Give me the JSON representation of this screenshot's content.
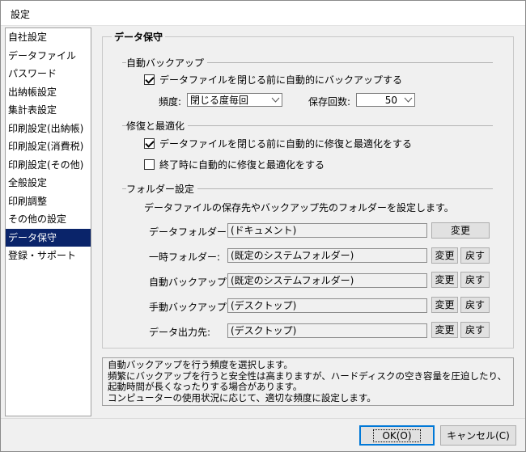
{
  "window": {
    "title": "設定"
  },
  "sidebar": {
    "items": [
      {
        "label": "自社設定"
      },
      {
        "label": "データファイル"
      },
      {
        "label": "パスワード"
      },
      {
        "label": "出納帳設定"
      },
      {
        "label": "集計表設定"
      },
      {
        "label": "印刷設定(出納帳)"
      },
      {
        "label": "印刷設定(消費税)"
      },
      {
        "label": "印刷設定(その他)"
      },
      {
        "label": "全般設定"
      },
      {
        "label": "印刷調整"
      },
      {
        "label": "その他の設定"
      },
      {
        "label": "データ保守",
        "selected": true
      },
      {
        "label": "登録・サポート"
      }
    ]
  },
  "panel": {
    "title": "データ保守"
  },
  "auto_backup": {
    "title": "自動バックアップ",
    "checkbox_label": "データファイルを閉じる前に自動的にバックアップする",
    "checked": true,
    "frequency_label": "頻度:",
    "frequency_value": "閉じる度毎回",
    "count_label": "保存回数:",
    "count_value": "50"
  },
  "repair": {
    "title": "修復と最適化",
    "option1_label": "データファイルを閉じる前に自動的に修復と最適化をする",
    "option1_checked": true,
    "option2_label": "終了時に自動的に修復と最適化をする",
    "option2_checked": false
  },
  "folders": {
    "title": "フォルダー設定",
    "description": "データファイルの保存先やバックアップ先のフォルダーを設定します。",
    "change_label": "変更",
    "reset_label": "戻す",
    "rows": [
      {
        "label": "データフォルダー:",
        "value": "(ドキュメント)"
      },
      {
        "label": "一時フォルダー:",
        "value": "(既定のシステムフォルダー)"
      },
      {
        "label": "自動バックアップ:",
        "value": "(既定のシステムフォルダー)"
      },
      {
        "label": "手動バックアップ:",
        "value": "(デスクトップ)"
      },
      {
        "label": "データ出力先:",
        "value": "(デスクトップ)"
      }
    ]
  },
  "help": {
    "lines": [
      "自動バックアップを行う頻度を選択します。",
      "頻繁にバックアップを行うと安全性は高まりますが、ハードディスクの空き容量を圧迫したり、",
      "起動時間が長くなったりする場合があります。",
      "コンピューターの使用状況に応じて、適切な頻度に設定します。"
    ]
  },
  "buttons": {
    "ok_label": "OK(O)",
    "cancel_label": "キャンセル(C)"
  }
}
